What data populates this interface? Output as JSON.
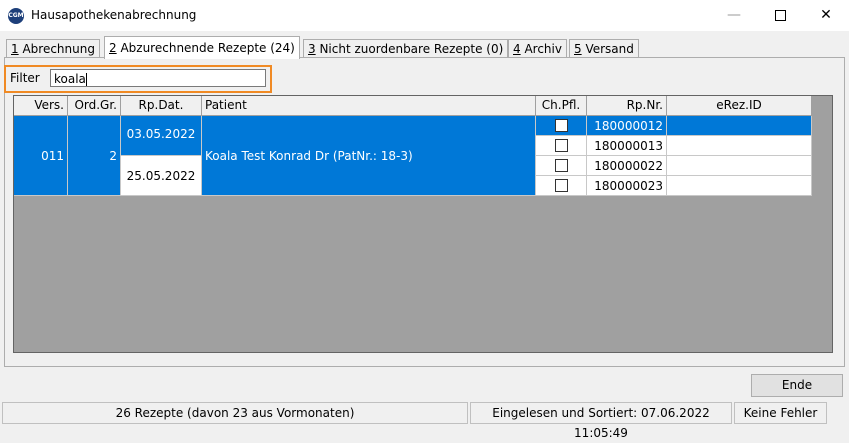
{
  "window": {
    "title": "Hausapothekenabrechnung",
    "app_icon_text": "CGM",
    "min_glyph": "—",
    "close_glyph": "✕"
  },
  "tabs": [
    {
      "key": "1",
      "label": " Abrechnung"
    },
    {
      "key": "2",
      "label": " Abzurechnende Rezepte (24)"
    },
    {
      "key": "3",
      "label": " Nicht zuordenbare Rezepte (0)"
    },
    {
      "key": "4",
      "label": " Archiv"
    },
    {
      "key": "5",
      "label": " Versand"
    }
  ],
  "filter": {
    "label": "Filter",
    "value": "koala"
  },
  "table": {
    "headers": {
      "vers": "Vers.",
      "ordgr": "Ord.Gr.",
      "rpdat": "Rp.Dat.",
      "patient": "Patient",
      "chpfl": "Ch.Pfl.",
      "rpnr": "Rp.Nr.",
      "erez": "eRez.ID"
    },
    "group": {
      "vers": "011",
      "ordgr": "2",
      "date1": "03.05.2022",
      "date2": "25.05.2022",
      "patient": "Koala Test Konrad Dr (PatNr.: 18-3)",
      "rp_numbers": [
        "180000012",
        "180000013",
        "180000022",
        "180000023"
      ],
      "ch_pfl_checked": [
        false,
        false,
        false,
        false
      ]
    }
  },
  "buttons": {
    "ende": "Ende"
  },
  "status": {
    "count": "26 Rezepte (davon 23 aus Vormonaten)",
    "sorted": "Eingelesen und Sortiert: 07.06.2022 11:05:49",
    "errors": "Keine Fehler"
  },
  "colors": {
    "selection": "#0078d7",
    "focus_highlight": "#f08a24"
  }
}
